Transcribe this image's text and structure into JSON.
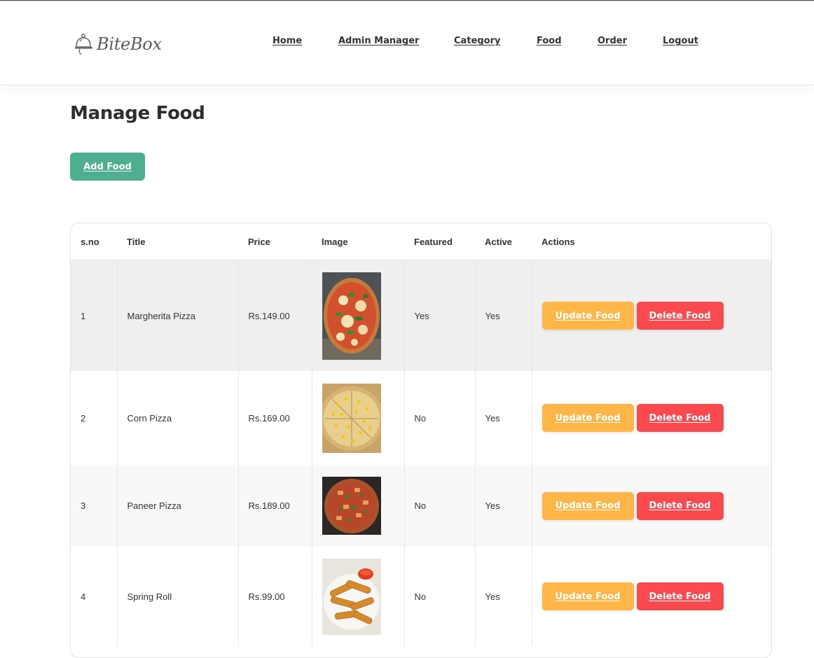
{
  "brand": {
    "name": "BiteBox"
  },
  "nav": {
    "home": "Home",
    "admin_manager": "Admin Manager",
    "category": "Category",
    "food": "Food",
    "order": "Order",
    "logout": "Logout"
  },
  "page": {
    "title": "Manage Food",
    "add_label": "Add Food"
  },
  "table": {
    "headers": {
      "sno": "s.no",
      "title": "Title",
      "price": "Price",
      "image": "Image",
      "featured": "Featured",
      "active": "Active",
      "actions": "Actions"
    },
    "rows": [
      {
        "sno": "1",
        "title": "Margherita Pizza",
        "price": "Rs.149.00",
        "image": "margherita-pizza-photo",
        "featured": "Yes",
        "active": "Yes"
      },
      {
        "sno": "2",
        "title": "Corn Pizza",
        "price": "Rs.169.00",
        "image": "corn-pizza-photo",
        "featured": "No",
        "active": "Yes"
      },
      {
        "sno": "3",
        "title": "Paneer Pizza",
        "price": "Rs.189.00",
        "image": "paneer-pizza-photo",
        "featured": "No",
        "active": "Yes"
      },
      {
        "sno": "4",
        "title": "Spring Roll",
        "price": "Rs.99.00",
        "image": "spring-roll-photo",
        "featured": "No",
        "active": "Yes"
      }
    ],
    "update_label": "Update Food",
    "delete_label": "Delete Food"
  },
  "colors": {
    "add_button": "#4daf8f",
    "update_button": "#ffb647",
    "delete_button": "#fb4a4f",
    "text": "#2b2b2b"
  }
}
